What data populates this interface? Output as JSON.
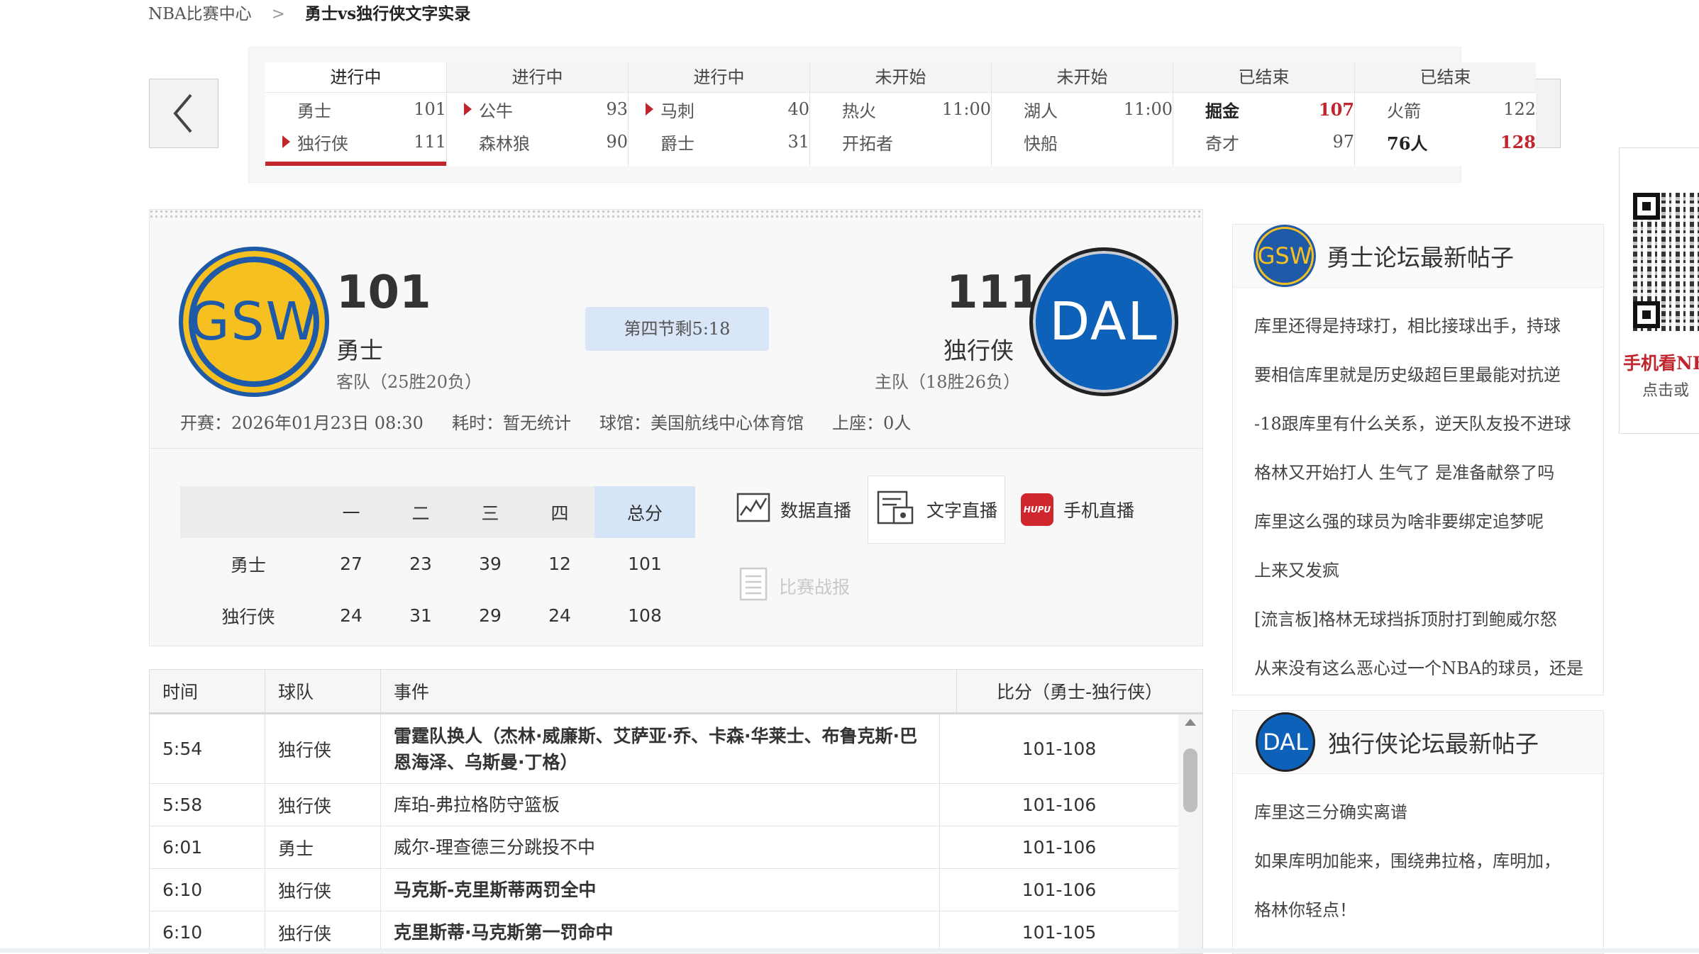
{
  "breadcrumb": {
    "home": "NBA比赛中心",
    "separator": ">",
    "current": "勇士vs独行侠文字实录"
  },
  "games": [
    {
      "status": "进行中",
      "active": true,
      "rows": [
        {
          "team": "勇士",
          "score": "101",
          "arrow": false,
          "win": false
        },
        {
          "team": "独行侠",
          "score": "111",
          "arrow": true,
          "win": false
        }
      ]
    },
    {
      "status": "进行中",
      "rows": [
        {
          "team": "公牛",
          "score": "93",
          "arrow": true,
          "win": false
        },
        {
          "team": "森林狼",
          "score": "90",
          "arrow": false,
          "win": false
        }
      ]
    },
    {
      "status": "进行中",
      "rows": [
        {
          "team": "马刺",
          "score": "40",
          "arrow": true,
          "win": false
        },
        {
          "team": "爵士",
          "score": "31",
          "arrow": false,
          "win": false
        }
      ]
    },
    {
      "status": "未开始",
      "rows": [
        {
          "team": "热火",
          "time": "11:00"
        },
        {
          "team": "开拓者",
          "time": ""
        }
      ]
    },
    {
      "status": "未开始",
      "rows": [
        {
          "team": "湖人",
          "time": "11:00"
        },
        {
          "team": "快船",
          "time": ""
        }
      ]
    },
    {
      "status": "已结束",
      "rows": [
        {
          "team": "掘金",
          "score": "107",
          "win": true
        },
        {
          "team": "奇才",
          "score": "97",
          "win": false
        }
      ]
    },
    {
      "status": "已结束",
      "rows": [
        {
          "team": "火箭",
          "score": "122",
          "win": false
        },
        {
          "team": "76人",
          "score": "128",
          "win": true
        }
      ]
    }
  ],
  "match": {
    "away": {
      "abbr": "GSW",
      "name": "勇士",
      "score": "101",
      "record": "客队（25胜20负）"
    },
    "home": {
      "abbr": "DAL",
      "name": "独行侠",
      "score": "111",
      "record": "主队（18胜26负）"
    },
    "status": "第四节剩5:18",
    "meta": {
      "start": "开赛：2026年01月23日 08:30",
      "duration": "耗时：暂无统计",
      "venue": "球馆：美国航线中心体育馆",
      "attendance": "上座：0人"
    }
  },
  "quarters": {
    "headers": [
      "",
      "一",
      "二",
      "三",
      "四",
      "总分"
    ],
    "rows": [
      {
        "team": "勇士",
        "q": [
          "27",
          "23",
          "39",
          "12"
        ],
        "total": "101"
      },
      {
        "team": "独行侠",
        "q": [
          "24",
          "31",
          "29",
          "24"
        ],
        "total": "108"
      }
    ]
  },
  "links": {
    "data_live": "数据直播",
    "text_live": "文字直播",
    "mobile_live": "手机直播",
    "report": "比赛战报",
    "hupu": "HUPU"
  },
  "events": {
    "headers": {
      "time": "时间",
      "team": "球队",
      "event": "事件",
      "score": "比分（勇士-独行侠）"
    },
    "rows": [
      {
        "time": "5:54",
        "team": "独行侠",
        "event": "雷霆队换人（杰林·威廉斯、艾萨亚·乔、卡森·华莱士、布鲁克斯·巴恩海泽、乌斯曼·丁格）",
        "score": "101-108",
        "bold": true
      },
      {
        "time": "5:58",
        "team": "独行侠",
        "event": "库珀-弗拉格防守篮板",
        "score": "101-106",
        "bold": false
      },
      {
        "time": "6:01",
        "team": "勇士",
        "event": "威尔-理查德三分跳投不中",
        "score": "101-106",
        "bold": false
      },
      {
        "time": "6:10",
        "team": "独行侠",
        "event": "马克斯-克里斯蒂两罚全中",
        "score": "101-106",
        "bold": true
      },
      {
        "time": "6:10",
        "team": "独行侠",
        "event": "克里斯蒂·马克斯第一罚命中",
        "score": "101-105",
        "bold": true
      }
    ]
  },
  "forums": [
    {
      "abbr": "GSW",
      "title": "勇士论坛最新帖子",
      "posts": [
        "库里还得是持球打，相比接球出手，持球",
        "要相信库里就是历史级超巨里最能对抗逆",
        "-18跟库里有什么关系，逆天队友投不进球",
        "格林又开始打人 生气了 是准备献祭了吗",
        "库里这么强的球员为啥非要绑定追梦呢",
        "上来又发疯",
        "[流言板]格林无球挡拆顶肘打到鲍威尔怒",
        "从来没有这么恶心过一个NBA的球员，还是"
      ]
    },
    {
      "abbr": "DAL",
      "title": "独行侠论坛最新帖子",
      "posts": [
        "库里这三分确实离谱",
        "如果库明加能来，围绕弗拉格，库明加，",
        "格林你轻点！"
      ]
    }
  ],
  "qr": {
    "title": "手机看NBA",
    "sub": "点击或"
  },
  "colors": {
    "accent_red": "#c0262d",
    "gsw_blue": "#1f5aa8",
    "gsw_gold": "#f6c020",
    "dal_blue": "#0e61b8",
    "status_blue": "#d9e6f8"
  }
}
